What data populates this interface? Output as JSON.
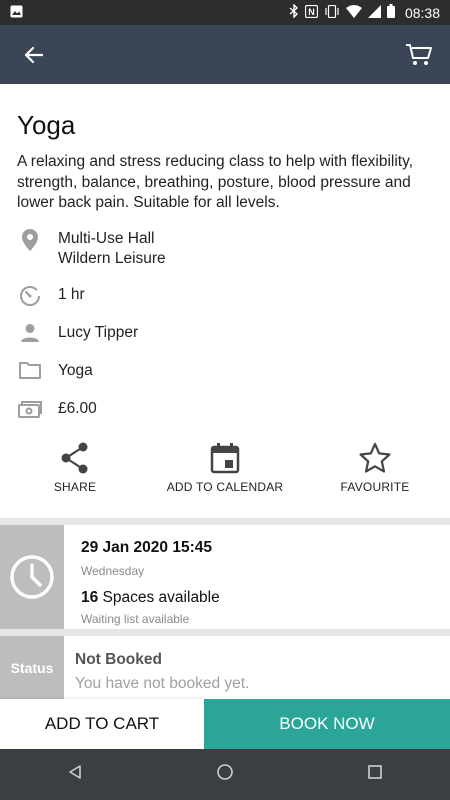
{
  "status_bar": {
    "time": "08:38",
    "icons": [
      "image-icon",
      "bluetooth-icon",
      "nfc-icon",
      "vibrate-icon",
      "wifi-icon",
      "signal-icon",
      "battery-icon"
    ]
  },
  "app_bar": {
    "back_icon": "arrow-left-icon",
    "cart_icon": "cart-icon",
    "background": "#3a4656"
  },
  "class": {
    "title": "Yoga",
    "description": "A relaxing and stress reducing class to help with flexibility, strength, balance, breathing, posture, blood pressure and lower back pain. Suitable for all levels.",
    "location_line1": "Multi-Use Hall",
    "location_line2": "Wildern Leisure",
    "duration": "1 hr",
    "instructor": "Lucy Tipper",
    "category": "Yoga",
    "price": "£6.00"
  },
  "actions": {
    "share": "SHARE",
    "add_to_calendar": "ADD TO CALENDAR",
    "favourite": "FAVOURITE"
  },
  "session": {
    "datetime": "29 Jan 2020 15:45",
    "weekday": "Wednesday",
    "spaces_count": "16",
    "spaces_text": " Spaces available",
    "waiting": "Waiting list available"
  },
  "booking_status": {
    "label": "Status",
    "status": "Not Booked",
    "message": "You have not booked yet."
  },
  "buttons": {
    "add_to_cart": "ADD TO CART",
    "book_now": "BOOK NOW",
    "book_now_color": "#2aa597"
  }
}
